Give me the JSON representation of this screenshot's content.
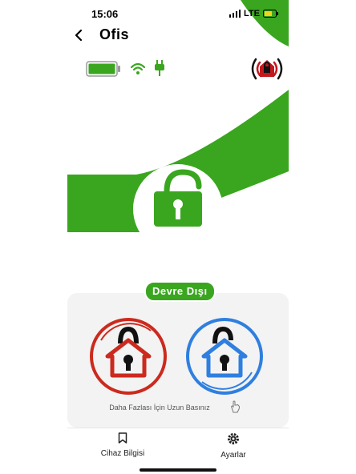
{
  "status": {
    "time": "15:06",
    "network": "LTE"
  },
  "header": {
    "title": "Ofis"
  },
  "icons": {
    "back": "chevron-left-icon",
    "battery": "battery-icon",
    "wifi": "wifi-icon",
    "power": "plug-icon",
    "alarm": "alarm-house-icon",
    "center": "unlocked-padlock-icon",
    "hint": "hand-tap-icon",
    "nav_info": "bookmark-icon",
    "nav_settings": "gear-icon"
  },
  "device": {
    "battery_level": 1.0,
    "wifi_connected": true,
    "power_connected": true
  },
  "state": {
    "label": "Devre Dışı"
  },
  "controls": {
    "arm_label": "",
    "disarm_label": ""
  },
  "hint": {
    "text": "Daha Fazlası İçin Uzun Basınız"
  },
  "nav": {
    "items": [
      {
        "label": "Cihaz Bilgisi"
      },
      {
        "label": "Ayarlar"
      }
    ]
  },
  "colors": {
    "accent_green": "#3aa61f",
    "arm_red": "#cc2a1e",
    "disarm_blue": "#2f7fe0",
    "alarm_red": "#c4161c"
  }
}
